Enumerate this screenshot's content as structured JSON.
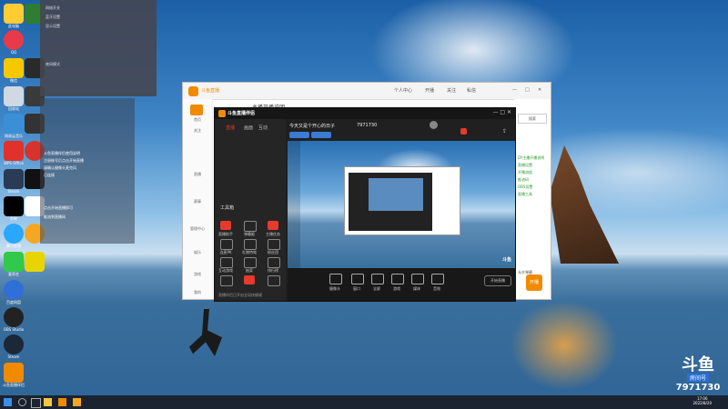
{
  "colors": {
    "accent": "#f08a00",
    "douyu_red": "#e63a2e",
    "taskbar": "#1b2330"
  },
  "browser": {
    "title": "斗鱼直播",
    "heading": "主播开播说明",
    "toolbar": [
      "个人中心",
      "开播",
      "关注",
      "私信"
    ],
    "right_btn": "搜索",
    "side_items": [
      "首页",
      "关注",
      "分类",
      "直播",
      "赛事",
      "管理中心",
      "娱乐",
      "游戏",
      "我的"
    ],
    "green_text": [
      "DY主播开播说明",
      "直播设置",
      "开播流程",
      "推流码",
      "OBS设置",
      "直播工具"
    ],
    "checkbox": "允许弹幕",
    "action": "开播"
  },
  "app": {
    "brand": "斗鱼直播伴侣",
    "tabs": [
      "直播",
      "画面",
      "互动"
    ],
    "room_title": "今天又是个开心的日子",
    "room_id": "7971730",
    "tools_header": "工具箱",
    "tools": [
      "直播助手",
      "弹幕姬",
      "主播任务",
      "连麦PK",
      "礼物特效",
      "粉丝团",
      "互动游戏",
      "抽奖",
      "排行榜",
      "背景音乐",
      "直播间",
      "更多"
    ],
    "controls": [
      "摄像头",
      "窗口",
      "全屏",
      "游戏",
      "媒体",
      "音效"
    ],
    "start_btn": "开始直播",
    "footer": "直播伴侣已开启全局快捷键"
  },
  "desktop_icons": [
    "此电脑",
    "回收站",
    "QQ",
    "微信",
    "斗鱼直播伴侣",
    "网易云音乐",
    "WPS Office",
    "抖音",
    "剪映",
    "Steam",
    "OBS Studio",
    "腾讯视频",
    "爱奇艺",
    "百度网盘"
  ],
  "popup": {
    "lines": [
      "网络开关",
      "蓝牙设置",
      "显示设置",
      "夜间模式"
    ]
  },
  "panel": {
    "lines": [
      "斗鱼直播伴侣使用说明",
      "注册账号后点击开始直播",
      "请确认摄像头麦克风",
      "已连接",
      "点击开始直播即可",
      "推流到直播间"
    ]
  },
  "taskbar": {
    "time": "17:06",
    "date": "2022/8/20"
  },
  "watermark": {
    "brand": "斗鱼",
    "room_label": "房间号",
    "room_id": "7971730"
  }
}
